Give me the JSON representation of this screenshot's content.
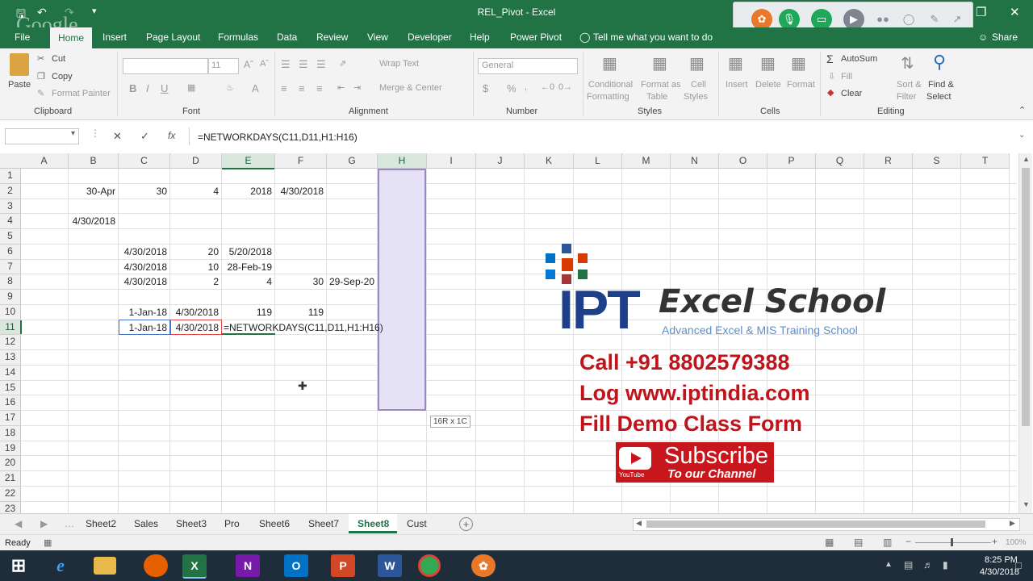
{
  "window": {
    "title": "REL_Pivot  -  Excel",
    "watermark": "Google"
  },
  "qat": {
    "save_icon": "save-icon",
    "undo": "↶",
    "redo": "↷"
  },
  "tabs": [
    "File",
    "Home",
    "Insert",
    "Page Layout",
    "Formulas",
    "Data",
    "Review",
    "View",
    "Developer",
    "Help",
    "Power Pivot"
  ],
  "tell_me": "Tell me what you want to do",
  "share": "Share",
  "ribbon": {
    "clipboard": {
      "paste": "Paste",
      "cut": "Cut",
      "copy": "Copy",
      "format_painter": "Format Painter",
      "group": "Clipboard"
    },
    "font": {
      "size": "11",
      "group": "Font",
      "bold": "B",
      "italic": "I",
      "underline": "U"
    },
    "alignment": {
      "wrap": "Wrap Text",
      "merge": "Merge & Center",
      "group": "Alignment"
    },
    "number": {
      "format": "General",
      "group": "Number",
      "currency": "$",
      "percent": "%"
    },
    "styles": {
      "conditional1": "Conditional",
      "conditional2": "Formatting",
      "format_table1": "Format as",
      "format_table2": "Table",
      "cell_styles1": "Cell",
      "cell_styles2": "Styles",
      "group": "Styles"
    },
    "cells": {
      "insert": "Insert",
      "delete": "Delete",
      "format": "Format",
      "group": "Cells"
    },
    "editing": {
      "autosum": "AutoSum",
      "fill": "Fill",
      "clear": "Clear",
      "sort1": "Sort &",
      "sort2": "Filter",
      "find1": "Find &",
      "find2": "Select",
      "group": "Editing"
    }
  },
  "formula_bar": {
    "name_box": "",
    "cancel": "✕",
    "enter": "✓",
    "fx": "fx",
    "formula": "=NETWORKDAYS(C11,D11,H1:H16)"
  },
  "grid": {
    "columns": [
      "A",
      "B",
      "C",
      "D",
      "E",
      "F",
      "G",
      "H",
      "I",
      "J",
      "K",
      "L",
      "M",
      "N",
      "O",
      "P",
      "Q",
      "R",
      "S",
      "T"
    ],
    "rows": [
      "1",
      "2",
      "3",
      "4",
      "5",
      "6",
      "7",
      "8",
      "9",
      "10",
      "11",
      "12",
      "13",
      "14",
      "15",
      "16",
      "17",
      "18",
      "19",
      "20",
      "21",
      "22",
      "23"
    ],
    "cells": {
      "B2": "30-Apr",
      "C2": "30",
      "D2": "4",
      "E2": "2018",
      "F2": "4/30/2018",
      "B4": "4/30/2018",
      "C6": "4/30/2018",
      "D6": "20",
      "E6": "5/20/2018",
      "C7": "4/30/2018",
      "D7": "10",
      "E7": "28-Feb-19",
      "C8": "4/30/2018",
      "D8": "2",
      "E8": "4",
      "F8": "30",
      "G8": "29-Sep-20",
      "C10": "1-Jan-18",
      "D10": "4/30/2018",
      "E10": "119",
      "F10": "119",
      "C11": "1-Jan-18",
      "D11": "4/30/2018",
      "E11": "=NETWORKDAYS(C11,D11,H1:H16)"
    },
    "selection_tip": "16R x 1C"
  },
  "branding": {
    "ipt": "IPT",
    "school": "Excel School",
    "tagline": "Advanced Excel & MIS Training School",
    "call": "Call +91 8802579388",
    "log": "Log www.iptindia.com",
    "fill": "Fill Demo Class Form",
    "subscribe": "Subscribe",
    "channel": "To our Channel",
    "youtube": "YouTube"
  },
  "sheets": {
    "tabs": [
      "Sheet2",
      "Sales",
      "Sheet3",
      "Pro",
      "Sheet6",
      "Sheet7",
      "Sheet8",
      "Cust"
    ],
    "active": "Sheet8",
    "add": "+"
  },
  "status": {
    "ready": "Ready",
    "zoom": "100%"
  },
  "taskbar": {
    "time": "8:25 PM",
    "date": "4/30/2018"
  },
  "colors": {
    "excel_green": "#217346",
    "selection": "#e4e0f4",
    "brand_blue": "#1e3f8a",
    "brand_red": "#c0141c"
  }
}
